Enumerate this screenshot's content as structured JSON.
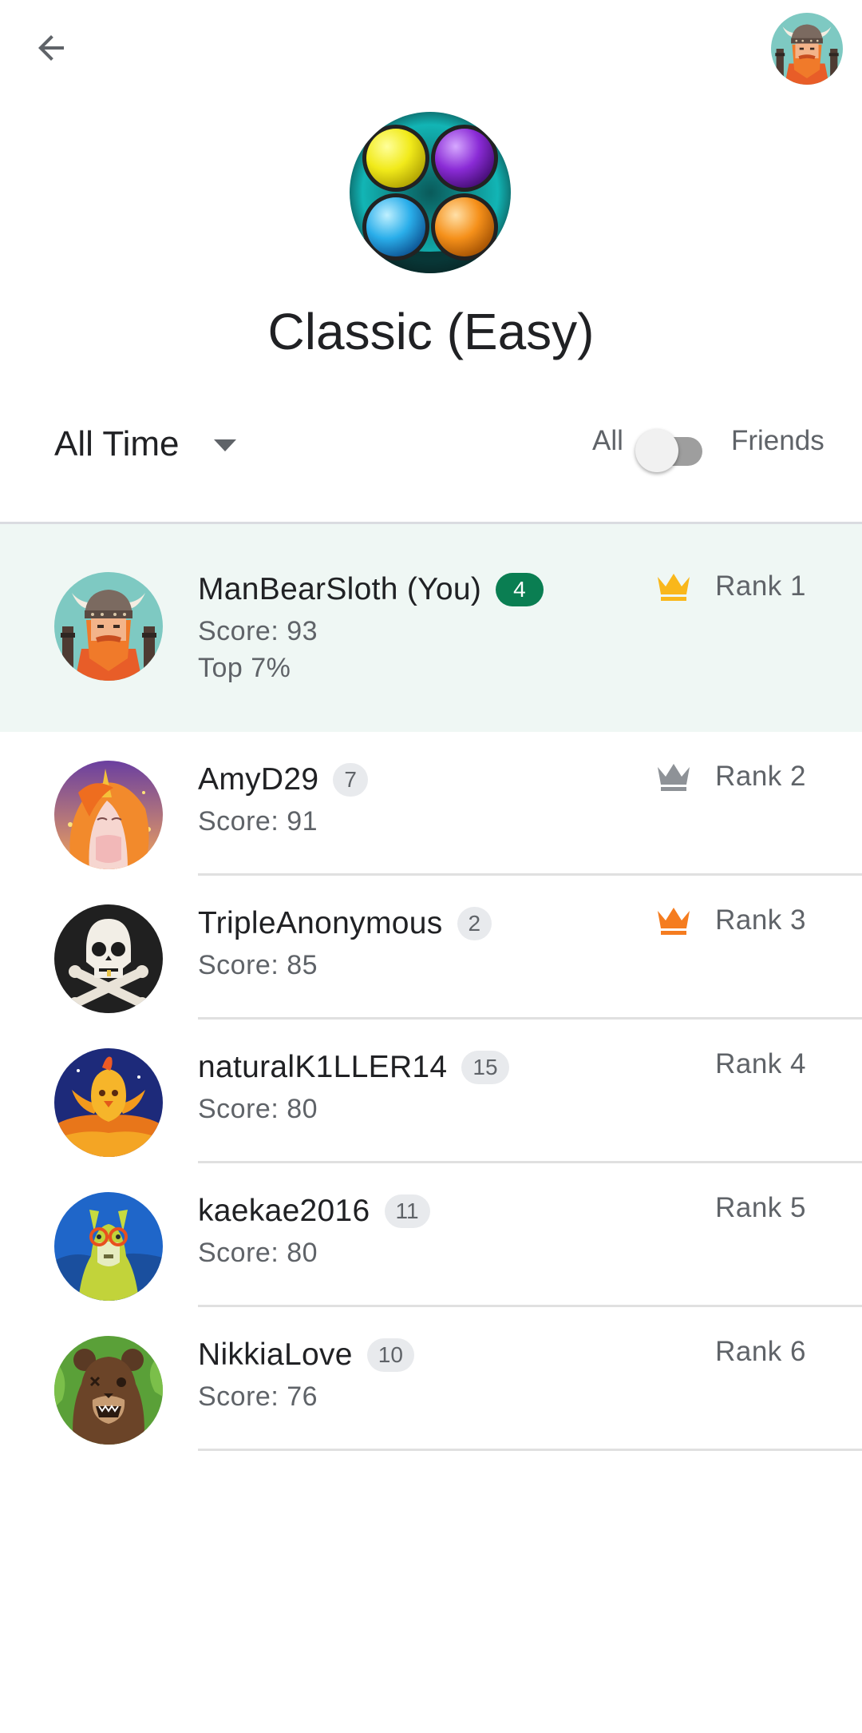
{
  "header": {
    "back_icon": "arrow-back-icon",
    "profile_avatar": "viking-avatar"
  },
  "game": {
    "title": "Classic (Easy)",
    "icon": "four-colored-buttons-icon"
  },
  "filters": {
    "time_period": "All Time",
    "toggle_left": "All",
    "toggle_right": "Friends",
    "friends_only": false
  },
  "leaderboard": [
    {
      "name": "ManBearSloth (You)",
      "badge": "4",
      "score": "Score: 93",
      "top": "Top 7%",
      "rank": "Rank 1",
      "crown": "gold",
      "avatar": "viking"
    },
    {
      "name": "AmyD29",
      "badge": "7",
      "score": "Score: 91",
      "rank": "Rank 2",
      "crown": "silver",
      "avatar": "unicorn"
    },
    {
      "name": "TripleAnonymous",
      "badge": "2",
      "score": "Score: 85",
      "rank": "Rank 3",
      "crown": "bronze",
      "avatar": "skull"
    },
    {
      "name": "naturalK1LLER14",
      "badge": "15",
      "score": "Score: 80",
      "rank": "Rank 4",
      "avatar": "phoenix"
    },
    {
      "name": "kaekae2016",
      "badge": "11",
      "score": "Score: 80",
      "rank": "Rank 5",
      "avatar": "llama"
    },
    {
      "name": "NikkiaLove",
      "badge": "10",
      "score": "Score: 76",
      "rank": "Rank 6",
      "avatar": "bear"
    }
  ],
  "colors": {
    "you_badge": "#0a7e52",
    "highlight_row": "#eff7f4",
    "crown_gold": "#f9b71b",
    "crown_silver": "#8e9297",
    "crown_bronze": "#f57c1f"
  }
}
